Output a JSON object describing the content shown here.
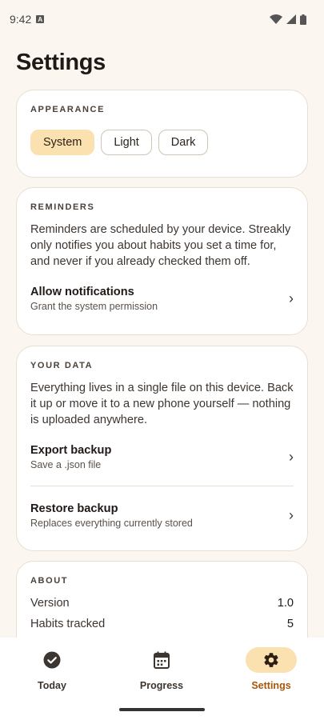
{
  "status_bar": {
    "time": "9:42",
    "badge": "A"
  },
  "title": "Settings",
  "appearance": {
    "heading": "APPEARANCE",
    "options": [
      "System",
      "Light",
      "Dark"
    ],
    "selected": "System"
  },
  "reminders": {
    "heading": "REMINDERS",
    "description": "Reminders are scheduled by your device. Streakly only notifies you about habits you set a time for, and never if you already checked them off.",
    "allow": {
      "title": "Allow notifications",
      "subtitle": "Grant the system permission"
    }
  },
  "your_data": {
    "heading": "YOUR DATA",
    "description": "Everything lives in a single file on this device. Back it up or move it to a new phone yourself — nothing is uploaded anywhere.",
    "export": {
      "title": "Export backup",
      "subtitle": "Save a .json file"
    },
    "restore": {
      "title": "Restore backup",
      "subtitle": "Replaces everything currently stored"
    }
  },
  "about": {
    "heading": "ABOUT",
    "version_label": "Version",
    "version_value": "1.0",
    "habits_label": "Habits tracked",
    "habits_value": "5"
  },
  "nav": {
    "today": "Today",
    "progress": "Progress",
    "settings": "Settings",
    "active": "settings"
  },
  "colors": {
    "background": "#FBF6F0",
    "accent_fill": "#FBE1B0",
    "accent_text": "#A8560A"
  }
}
